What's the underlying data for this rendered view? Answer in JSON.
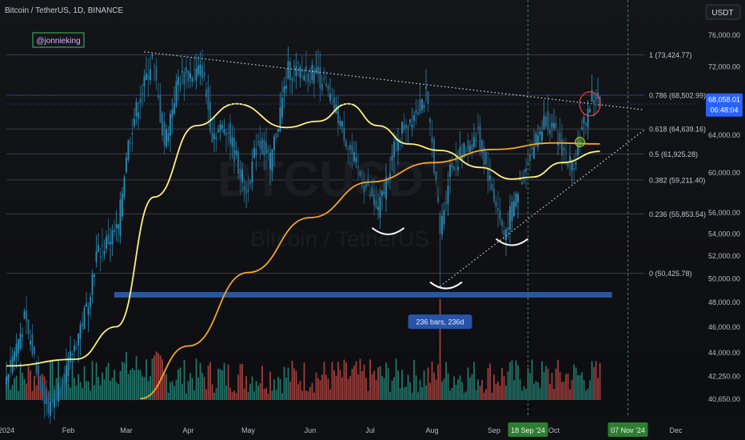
{
  "header": {
    "symbol_text": "Bitcoin / TetherUS, 1D, BINANCE",
    "currency_button": "USDT",
    "author_tag": "@jonnieking"
  },
  "watermark": {
    "ticker": "BTCUSDT",
    "name": "Bitcoin / TetherUS"
  },
  "colors": {
    "background": "#0f1014",
    "up_candle": "#2e8fb8",
    "down_candle": "#2b6f91",
    "vol_up": "#2a8c7c",
    "vol_down": "#c04a46",
    "ma_fast": "#fff27a",
    "ma_slow": "#f5a623",
    "support_zone": "#2f5fa8",
    "fib_line": "#3b3f4a",
    "highlight_date": "#2e7d32",
    "price_tag": "#2962ff"
  },
  "icons": [
    "circle-highlight",
    "bowl-curve"
  ],
  "chart_data": {
    "type": "candlestick",
    "y_scale": "log",
    "ylim": [
      40000,
      78500
    ],
    "y_ticks": [
      "76,000.00",
      "72,000.00",
      "68,000.00",
      "64,000.00",
      "60,000.00",
      "56,000.00",
      "54,000.00",
      "52,000.00",
      "50,000.00",
      "48,000.00",
      "46,000.00",
      "44,000.00",
      "42,250.00",
      "40,650.00"
    ],
    "x_range": [
      "2024-01-01",
      "2024-12-31"
    ],
    "x_ticks": [
      "2024",
      "Feb",
      "Mar",
      "Apr",
      "May",
      "Jun",
      "Jul",
      "Aug",
      "Sep",
      "Oct",
      "Dec"
    ],
    "x_ticks_dates": [
      "2024-01-01",
      "2024-02-01",
      "2024-03-01",
      "2024-04-01",
      "2024-05-01",
      "2024-06-01",
      "2024-07-01",
      "2024-08-01",
      "2024-09-01",
      "2024-10-01",
      "2024-12-01"
    ],
    "highlight_dates": [
      {
        "label": "18 Sep '24",
        "date": "2024-09-18"
      },
      {
        "label": "07 Nov '24",
        "date": "2024-11-07"
      }
    ],
    "last_price": {
      "label": "68,058.01",
      "countdown": "06:48:04",
      "value": 68058.01
    },
    "close_series": [
      {
        "date": "2024-01-01",
        "value": 42300
      },
      {
        "date": "2024-01-10",
        "value": 46500
      },
      {
        "date": "2024-01-22",
        "value": 39800
      },
      {
        "date": "2024-02-01",
        "value": 43000
      },
      {
        "date": "2024-02-10",
        "value": 47500
      },
      {
        "date": "2024-02-15",
        "value": 52000
      },
      {
        "date": "2024-02-26",
        "value": 54500
      },
      {
        "date": "2024-03-01",
        "value": 62000
      },
      {
        "date": "2024-03-05",
        "value": 66000
      },
      {
        "date": "2024-03-14",
        "value": 73000
      },
      {
        "date": "2024-03-20",
        "value": 63000
      },
      {
        "date": "2024-03-27",
        "value": 70500
      },
      {
        "date": "2024-04-08",
        "value": 71500
      },
      {
        "date": "2024-04-13",
        "value": 64000
      },
      {
        "date": "2024-04-20",
        "value": 65000
      },
      {
        "date": "2024-04-30",
        "value": 58000
      },
      {
        "date": "2024-05-06",
        "value": 63500
      },
      {
        "date": "2024-05-12",
        "value": 61000
      },
      {
        "date": "2024-05-21",
        "value": 71500
      },
      {
        "date": "2024-06-05",
        "value": 71000
      },
      {
        "date": "2024-06-15",
        "value": 66000
      },
      {
        "date": "2024-06-24",
        "value": 60500
      },
      {
        "date": "2024-07-05",
        "value": 56000
      },
      {
        "date": "2024-07-15",
        "value": 64000
      },
      {
        "date": "2024-07-29",
        "value": 68500
      },
      {
        "date": "2024-08-02",
        "value": 61000
      },
      {
        "date": "2024-08-05",
        "value": 54000
      },
      {
        "date": "2024-08-10",
        "value": 60500
      },
      {
        "date": "2024-08-24",
        "value": 64000
      },
      {
        "date": "2024-09-06",
        "value": 53800
      },
      {
        "date": "2024-09-18",
        "value": 61500
      },
      {
        "date": "2024-09-27",
        "value": 66000
      },
      {
        "date": "2024-10-10",
        "value": 60500
      },
      {
        "date": "2024-10-20",
        "value": 68300
      },
      {
        "date": "2024-10-24",
        "value": 68058
      }
    ],
    "series": [
      {
        "type": "line",
        "points": [
          {
            "date": "2024-01-01",
            "value": 43000
          },
          {
            "date": "2024-02-05",
            "value": 43500
          },
          {
            "date": "2024-02-25",
            "value": 46000
          },
          {
            "date": "2024-03-15",
            "value": 57500
          },
          {
            "date": "2024-04-05",
            "value": 65000
          },
          {
            "date": "2024-04-25",
            "value": 67500
          },
          {
            "date": "2024-05-20",
            "value": 64800
          },
          {
            "date": "2024-06-05",
            "value": 65500
          },
          {
            "date": "2024-06-20",
            "value": 67500
          },
          {
            "date": "2024-07-05",
            "value": 65000
          },
          {
            "date": "2024-07-20",
            "value": 63000
          },
          {
            "date": "2024-08-05",
            "value": 62300
          },
          {
            "date": "2024-08-25",
            "value": 60500
          },
          {
            "date": "2024-09-10",
            "value": 59300
          },
          {
            "date": "2024-09-20",
            "value": 59500
          },
          {
            "date": "2024-10-05",
            "value": 61000
          },
          {
            "date": "2024-10-24",
            "value": 62200
          }
        ]
      },
      {
        "type": "line",
        "points": [
          {
            "date": "2024-03-08",
            "value": 40650
          },
          {
            "date": "2024-04-01",
            "value": 44500
          },
          {
            "date": "2024-05-01",
            "value": 50500
          },
          {
            "date": "2024-06-01",
            "value": 55500
          },
          {
            "date": "2024-07-01",
            "value": 59000
          },
          {
            "date": "2024-08-01",
            "value": 61000
          },
          {
            "date": "2024-09-01",
            "value": 62400
          },
          {
            "date": "2024-10-01",
            "value": 63100
          },
          {
            "date": "2024-10-24",
            "value": 63000
          }
        ]
      }
    ],
    "fib_levels": [
      {
        "label": "1 (73,424.77)",
        "value": 73424.77
      },
      {
        "label": "0.786 (68,502.99)",
        "value": 68502.99
      },
      {
        "label": "0.618 (64,639.16)",
        "value": 64639.16
      },
      {
        "label": "0.5 (61,925.28)",
        "value": 61925.28
      },
      {
        "label": "0.382 (59,211.40)",
        "value": 59211.4
      },
      {
        "label": "0.236 (55,853.54)",
        "value": 55853.54
      },
      {
        "label": "0 (50,425.78)",
        "value": 50425.78
      }
    ],
    "trendlines": [
      {
        "style": "dotted",
        "from": {
          "date": "2024-03-10",
          "value": 73800
        },
        "to": {
          "date": "2024-11-15",
          "value": 66800
        }
      },
      {
        "style": "dotted",
        "from": {
          "date": "2024-08-05",
          "value": 49300
        },
        "to": {
          "date": "2024-11-15",
          "value": 64500
        }
      }
    ],
    "support_zone": {
      "value": 48600,
      "from": "2024-02-24",
      "to": "2024-10-30"
    },
    "range_label": {
      "text": "236 bars, 236d",
      "date": "2024-08-05",
      "value": 46400
    },
    "annotations": [
      {
        "type": "bowl",
        "date": "2024-07-10",
        "value": 54000
      },
      {
        "type": "bowl",
        "date": "2024-08-08",
        "value": 49200
      },
      {
        "type": "bowl",
        "date": "2024-09-10",
        "value": 53000
      },
      {
        "type": "circle",
        "date": "2024-10-19",
        "value": 67500
      },
      {
        "type": "circle",
        "date": "2024-10-14",
        "value": 63200
      }
    ],
    "volume_ylim": [
      0,
      100
    ]
  }
}
